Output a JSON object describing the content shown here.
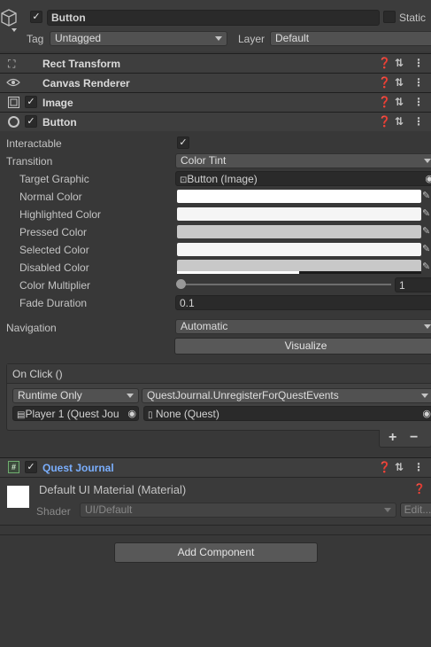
{
  "gameobject": {
    "icon": "cube-icon",
    "active_checked": true,
    "name": "Button",
    "static_label": "Static",
    "tag_label": "Tag",
    "tag_value": "Untagged",
    "layer_label": "Layer",
    "layer_value": "Default"
  },
  "components": {
    "rect_transform": "Rect Transform",
    "canvas_renderer": "Canvas Renderer",
    "image": "Image",
    "button": "Button",
    "quest_journal": "Quest Journal"
  },
  "button_props": {
    "interactable_label": "Interactable",
    "interactable_checked": true,
    "transition_label": "Transition",
    "transition_value": "Color Tint",
    "target_graphic_label": "Target Graphic",
    "target_graphic_value": "Button (Image)",
    "normal_color_label": "Normal Color",
    "highlighted_color_label": "Highlighted Color",
    "pressed_color_label": "Pressed Color",
    "selected_color_label": "Selected Color",
    "disabled_color_label": "Disabled Color",
    "color_multiplier_label": "Color Multiplier",
    "color_multiplier_value": "1",
    "fade_duration_label": "Fade Duration",
    "fade_duration_value": "0.1",
    "navigation_label": "Navigation",
    "navigation_value": "Automatic",
    "visualize_label": "Visualize"
  },
  "colors": {
    "normal": "#ffffff",
    "highlighted": "#f5f5f5",
    "pressed": "#c8c8c8",
    "selected": "#f5f5f5",
    "disabled": "#c8c8c8",
    "accent_link": "#7aaefc"
  },
  "on_click": {
    "header": "On Click ()",
    "runtime_value": "Runtime Only",
    "function_value": "QuestJournal.UnregisterForQuestEvents",
    "target_object": "Player 1 (Quest Jou",
    "argument_value": "None (Quest)",
    "add_label": "+",
    "remove_label": "−"
  },
  "material": {
    "name": "Default UI Material (Material)",
    "shader_label": "Shader",
    "shader_value": "UI/Default",
    "edit_label": "Edit..."
  },
  "add_component_label": "Add Component"
}
